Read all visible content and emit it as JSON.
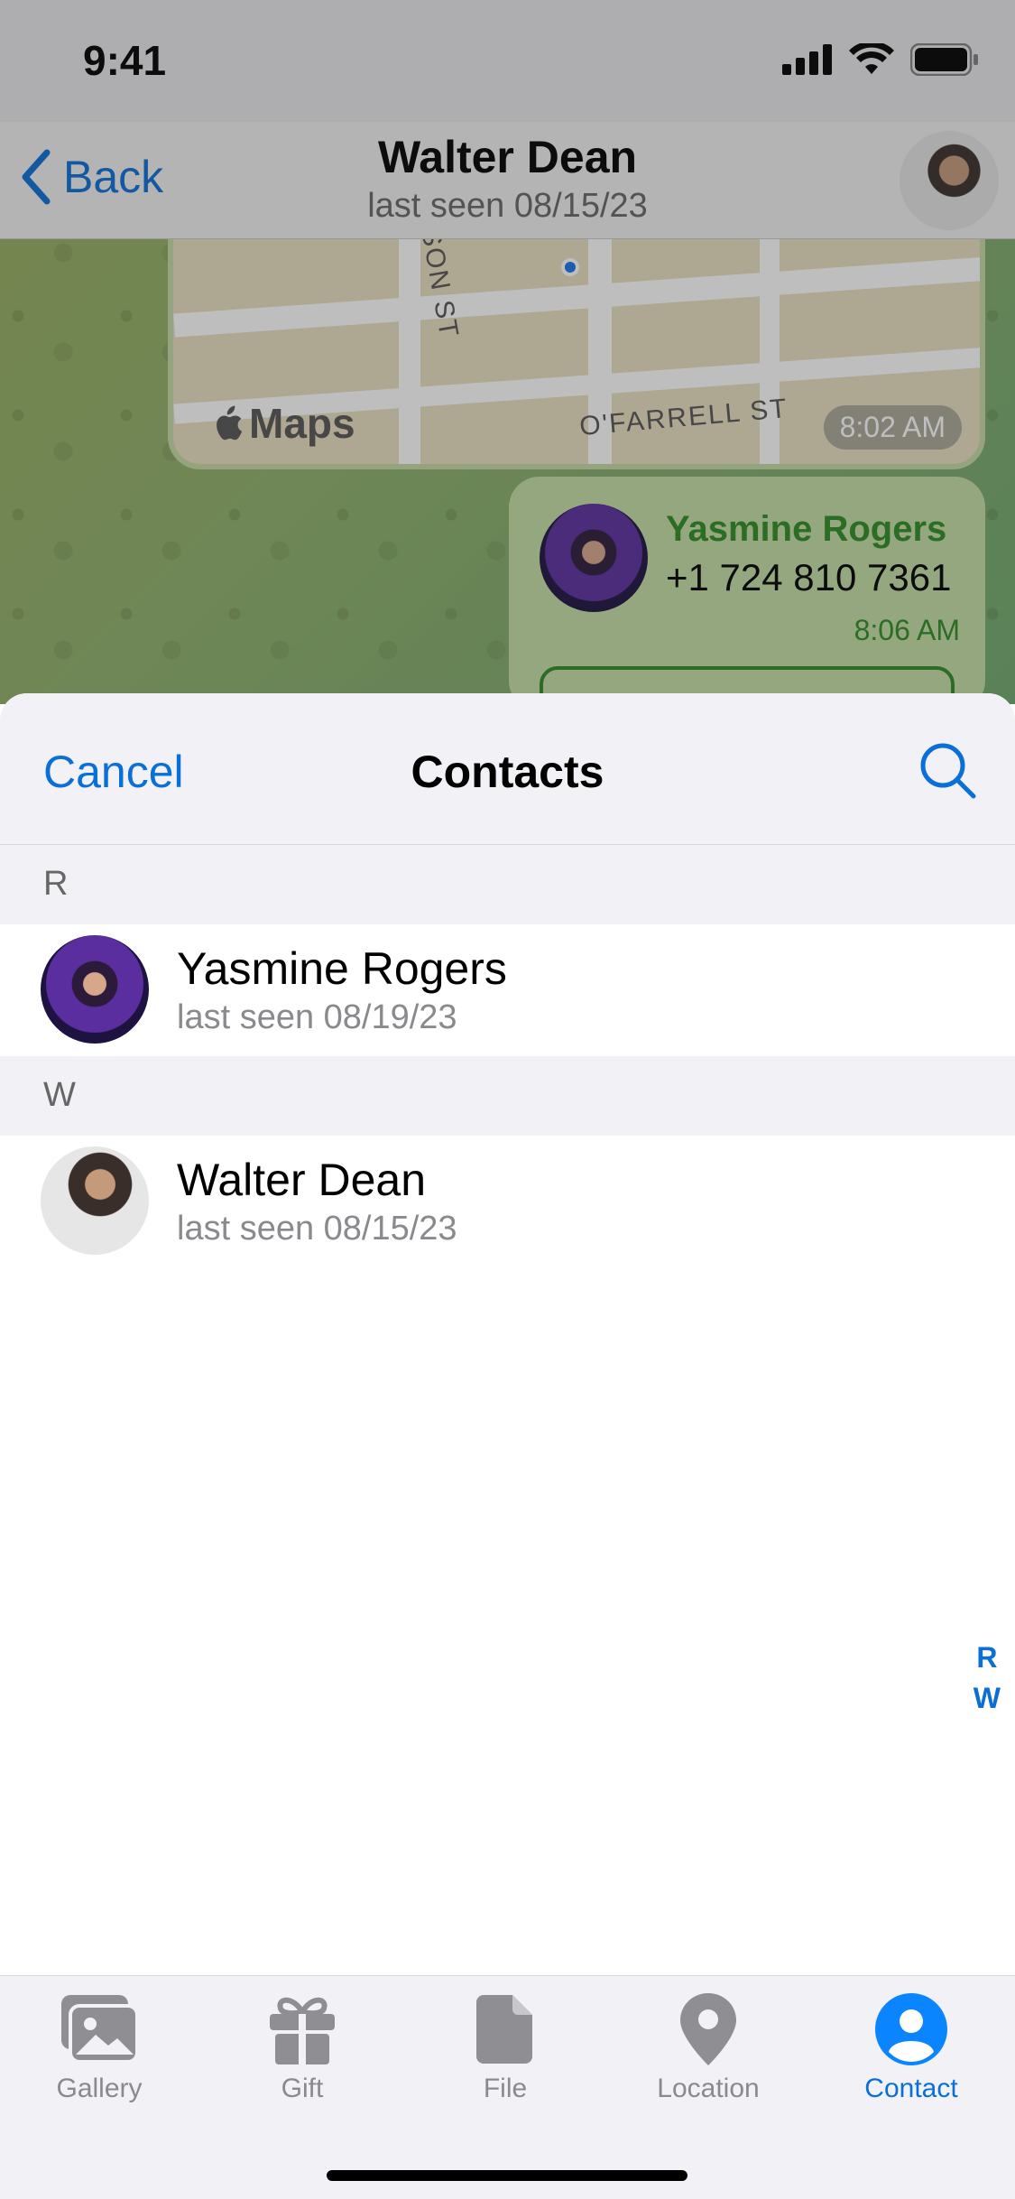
{
  "status_bar": {
    "time": "9:41"
  },
  "chat": {
    "header": {
      "back_label": "Back",
      "title": "Walter Dean",
      "subtitle": "last seen 08/15/23"
    },
    "map_message": {
      "maps_label": "Maps",
      "street_1": "O'FARRELL ST",
      "street_2": "ASON ST",
      "time": "8:02 AM"
    },
    "contact_message": {
      "name": "Yasmine Rogers",
      "phone": "+1 724 810 7361",
      "time": "8:06 AM"
    }
  },
  "sheet": {
    "cancel_label": "Cancel",
    "title": "Contacts",
    "sections": [
      {
        "letter": "R",
        "contacts": [
          {
            "name": "Yasmine Rogers",
            "status": "last seen 08/19/23"
          }
        ]
      },
      {
        "letter": "W",
        "contacts": [
          {
            "name": "Walter Dean",
            "status": "last seen 08/15/23"
          }
        ]
      }
    ],
    "index": [
      "R",
      "W"
    ]
  },
  "tab_bar": {
    "tabs": [
      {
        "label": "Gallery",
        "icon": "gallery-icon",
        "active": false
      },
      {
        "label": "Gift",
        "icon": "gift-icon",
        "active": false
      },
      {
        "label": "File",
        "icon": "file-icon",
        "active": false
      },
      {
        "label": "Location",
        "icon": "location-icon",
        "active": false
      },
      {
        "label": "Contact",
        "icon": "contact-icon",
        "active": true
      }
    ]
  },
  "colors": {
    "accent": "#0a6fd6",
    "bubble_green": "#2e8b24"
  }
}
